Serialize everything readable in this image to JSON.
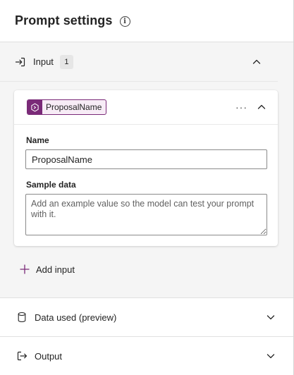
{
  "header": {
    "title": "Prompt settings",
    "info_icon": "info-icon"
  },
  "input_section": {
    "label": "Input",
    "count": "1",
    "icon": "sign-in-icon",
    "expanded": true,
    "card": {
      "tag_label": "ProposalName",
      "tag_icon": "variable-hexagon-icon",
      "tag_color": "#7a2a78",
      "more_label": "···",
      "name_label": "Name",
      "name_value": "ProposalName",
      "sample_label": "Sample data",
      "sample_placeholder": "Add an example value so the model can test your prompt with it."
    },
    "add_input_label": "Add input"
  },
  "data_used": {
    "label": "Data used (preview)",
    "icon": "database-icon",
    "expanded": false
  },
  "output": {
    "label": "Output",
    "icon": "sign-out-icon",
    "expanded": false
  }
}
